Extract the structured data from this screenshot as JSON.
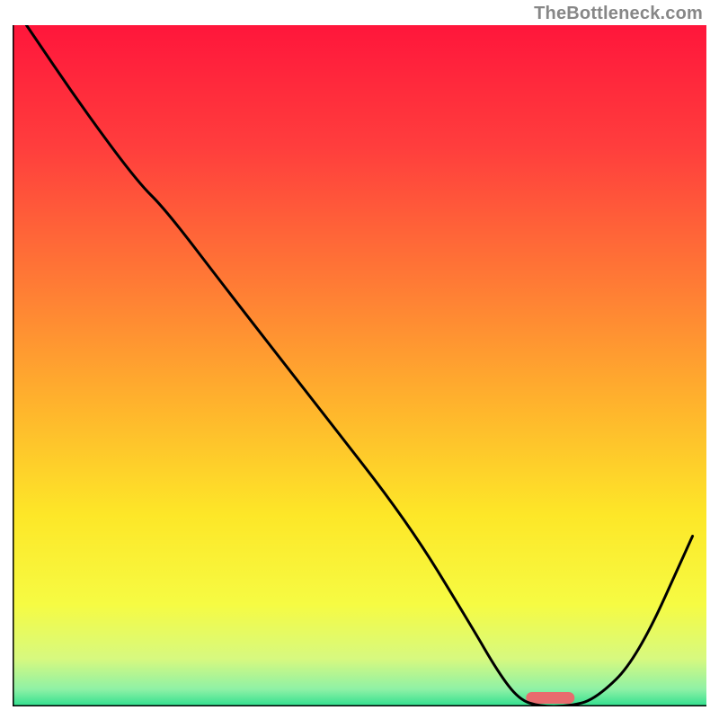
{
  "watermark": "TheBottleneck.com",
  "chart_data": {
    "type": "line",
    "title": "",
    "xlabel": "",
    "ylabel": "",
    "xlim": [
      0,
      100
    ],
    "ylim": [
      0,
      100
    ],
    "gradient_stops": [
      {
        "offset": 0,
        "color": "#ff163b"
      },
      {
        "offset": 0.18,
        "color": "#ff3e3d"
      },
      {
        "offset": 0.38,
        "color": "#ff7b35"
      },
      {
        "offset": 0.55,
        "color": "#ffb12d"
      },
      {
        "offset": 0.72,
        "color": "#fde728"
      },
      {
        "offset": 0.85,
        "color": "#f6fb43"
      },
      {
        "offset": 0.93,
        "color": "#d7f97f"
      },
      {
        "offset": 0.975,
        "color": "#8ef1a6"
      },
      {
        "offset": 1,
        "color": "#2fdf8e"
      }
    ],
    "series": [
      {
        "name": "curve",
        "type": "line",
        "stroke": "#000000",
        "x": [
          2,
          10,
          18,
          22,
          31,
          44,
          57,
          66,
          70,
          73,
          76,
          80,
          84,
          90,
          98
        ],
        "y": [
          100,
          88,
          77,
          73,
          61,
          44,
          27,
          12,
          5,
          1,
          0,
          0,
          1,
          7,
          25
        ]
      }
    ],
    "marker": {
      "name": "optimal-range",
      "x_center": 77.5,
      "y": 0,
      "width": 7,
      "color": "#e86b6e"
    },
    "axes": {
      "stroke": "#000000",
      "stroke_width": 3
    }
  }
}
